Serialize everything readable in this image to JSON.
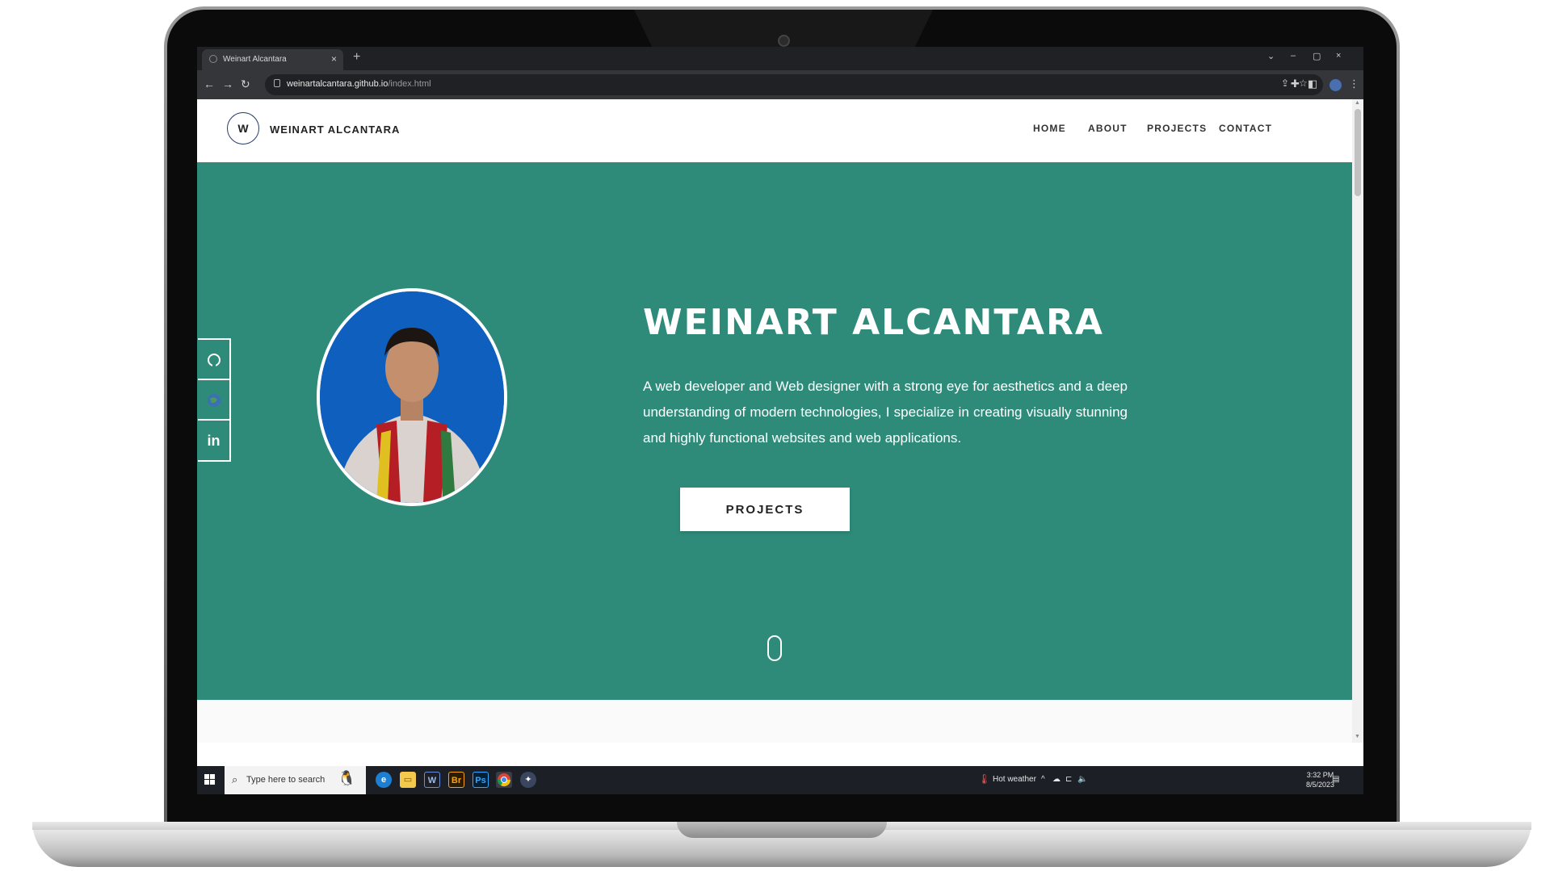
{
  "browser": {
    "tab_title": "Weinart Alcantara",
    "new_tab": "+",
    "tab_close": "×",
    "url_host": "weinartalcantara.github.io",
    "url_path": "/index.html",
    "window_controls": [
      "⌄",
      "–",
      "▢",
      "×"
    ]
  },
  "site": {
    "logo_letter": "W",
    "brand": "WEINART ALCANTARA",
    "nav": [
      "HOME",
      "ABOUT",
      "PROJECTS",
      "CONTACT"
    ],
    "hero_title": "WEINART ALCANTARA",
    "hero_description": "A web developer and Web designer with a strong eye for aesthetics and a deep understanding of modern technologies, I specialize in creating visually stunning and highly functional websites and web applications.",
    "hero_button": "PROJECTS",
    "social_linkedin": "in",
    "colors": {
      "hero_bg": "#2e8b7a",
      "text": "#ffffff",
      "avatar_bg": "#0f5fbf"
    }
  },
  "taskbar": {
    "search_placeholder": "Type here to search",
    "apps": [
      "edge",
      "file-explorer",
      "word",
      "bridge",
      "photoshop",
      "chrome",
      "app"
    ],
    "weather": "Hot weather",
    "time": "3:32 PM",
    "date": "8/5/2023"
  }
}
